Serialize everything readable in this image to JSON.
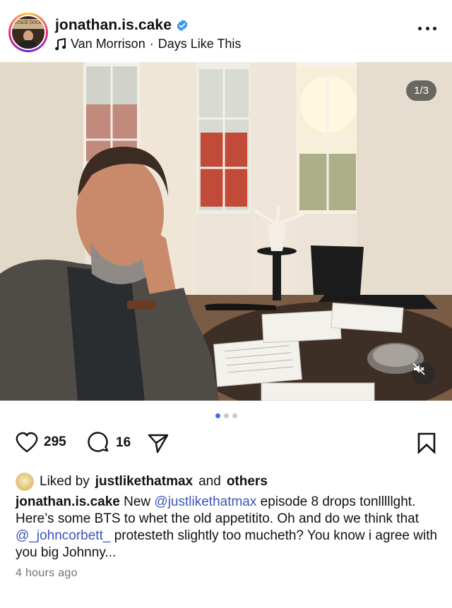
{
  "header": {
    "username": "jonathan.is.cake",
    "verified": true,
    "music": {
      "artist": "Van Morrison",
      "separator": "·",
      "song": "Days Like This"
    },
    "avatar_sign_text": "STAGE DOOR"
  },
  "post": {
    "image_counter": "1/3",
    "carousel_dots": 3,
    "active_dot": 0,
    "muted": true
  },
  "actions": {
    "like_count": "295",
    "comment_count": "16"
  },
  "likes": {
    "prefix": "Liked by",
    "user": "justlikethatmax",
    "connector": "and",
    "others": "others"
  },
  "caption": {
    "user": "jonathan.is.cake",
    "t1": "New",
    "mention1": "@justlikethatmax",
    "t2": "episode 8 drops tonlllllght. Here’s some BTS to whet the old appetitito. Oh and do we think that",
    "mention2": "@_johncorbett_",
    "t3": "protesteth slightly too mucheth? You know i agree with you big Johnny..."
  },
  "timestamp": "4 hours ago",
  "colors": {
    "mention": "#3b56b8",
    "verified": "#3897f0",
    "active_dot": "#3b6ff5"
  }
}
